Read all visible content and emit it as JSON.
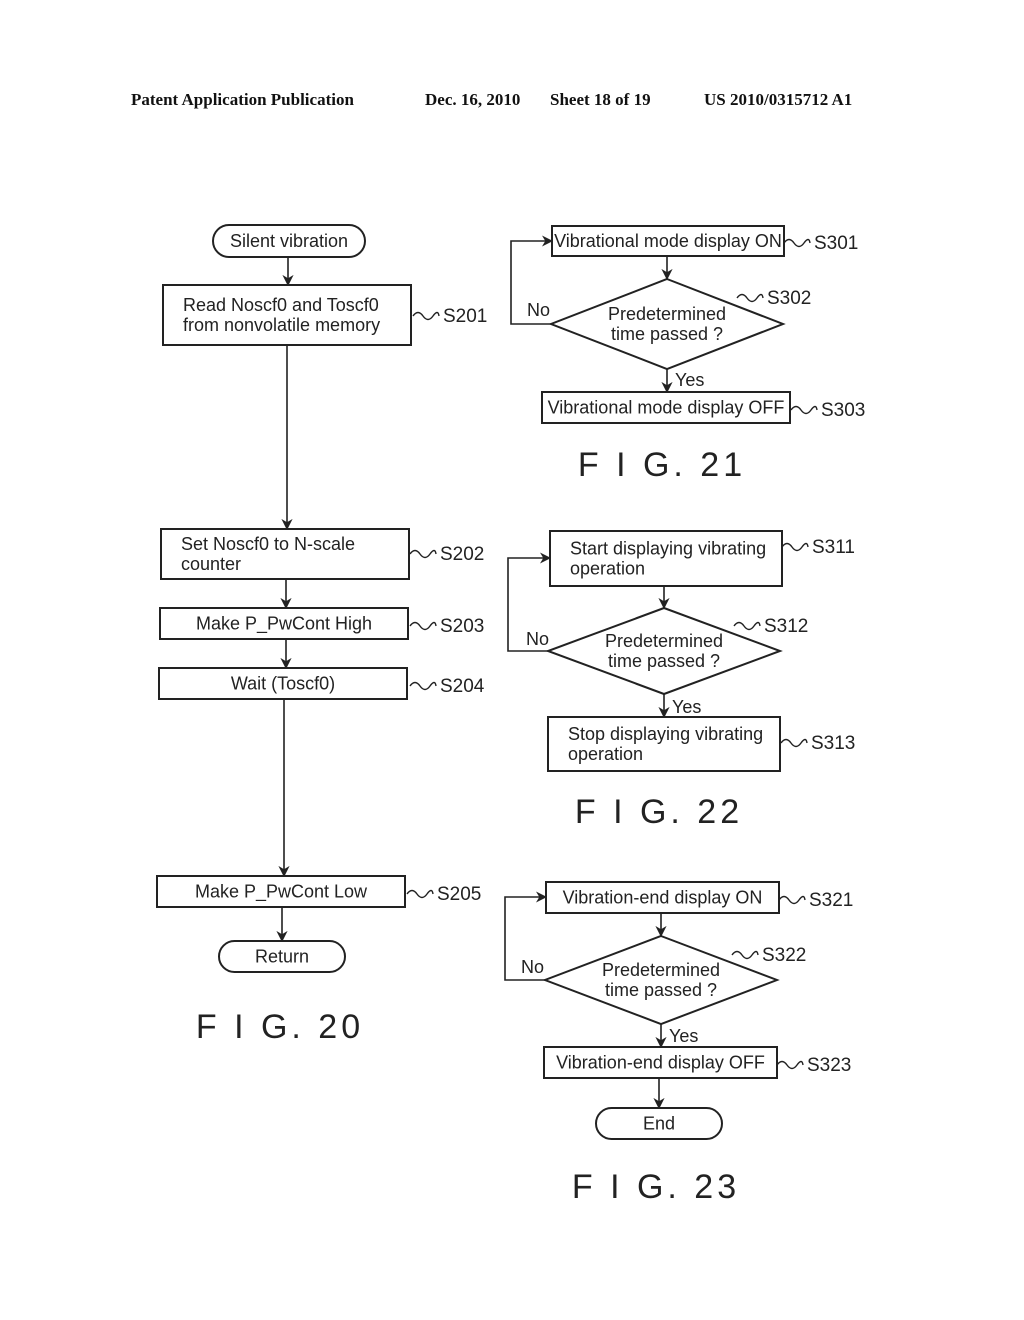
{
  "header": {
    "publication": "Patent Application Publication",
    "date": "Dec. 16, 2010",
    "sheet": "Sheet 18 of 19",
    "number": "US 2010/0315712 A1"
  },
  "figures": [
    {
      "id": "fig20",
      "caption": "F I G. 20",
      "nodes": [
        {
          "id": "start",
          "type": "terminal",
          "lines": [
            "Silent vibration"
          ]
        },
        {
          "id": "S201",
          "type": "process",
          "step": "S201",
          "lines": [
            "Read Noscf0 and Toscf0",
            "from nonvolatile memory"
          ]
        },
        {
          "id": "S202",
          "type": "process",
          "step": "S202",
          "lines": [
            "Set Noscf0 to N-scale",
            "counter"
          ]
        },
        {
          "id": "S203",
          "type": "process",
          "step": "S203",
          "lines": [
            "Make P_PwCont High"
          ]
        },
        {
          "id": "S204",
          "type": "process",
          "step": "S204",
          "lines": [
            "Wait (Toscf0)"
          ]
        },
        {
          "id": "S205",
          "type": "process",
          "step": "S205",
          "lines": [
            "Make P_PwCont Low"
          ]
        },
        {
          "id": "end",
          "type": "terminal",
          "lines": [
            "Return"
          ]
        }
      ],
      "edges": [
        {
          "from": "start",
          "to": "S201"
        },
        {
          "from": "S201",
          "to": "S202"
        },
        {
          "from": "S202",
          "to": "S203"
        },
        {
          "from": "S203",
          "to": "S204"
        },
        {
          "from": "S204",
          "to": "S205"
        },
        {
          "from": "S205",
          "to": "end"
        }
      ]
    },
    {
      "id": "fig21",
      "caption": "F I G. 21",
      "nodes": [
        {
          "id": "S301",
          "type": "process",
          "step": "S301",
          "lines": [
            "Vibrational mode display ON"
          ]
        },
        {
          "id": "S302",
          "type": "decision",
          "step": "S302",
          "lines": [
            "Predetermined",
            "time passed ?"
          ]
        },
        {
          "id": "S303",
          "type": "process",
          "step": "S303",
          "lines": [
            "Vibrational mode display OFF"
          ]
        }
      ],
      "edges": [
        {
          "from": "S301",
          "to": "S302"
        },
        {
          "from": "S302",
          "to": "S303",
          "label": "Yes"
        },
        {
          "from": "S302",
          "to": "S301",
          "label": "No"
        }
      ]
    },
    {
      "id": "fig22",
      "caption": "F I G. 22",
      "nodes": [
        {
          "id": "S311",
          "type": "process",
          "step": "S311",
          "lines": [
            "Start displaying vibrating",
            "operation"
          ]
        },
        {
          "id": "S312",
          "type": "decision",
          "step": "S312",
          "lines": [
            "Predetermined",
            "time passed ?"
          ]
        },
        {
          "id": "S313",
          "type": "process",
          "step": "S313",
          "lines": [
            "Stop displaying vibrating",
            "operation"
          ]
        }
      ],
      "edges": [
        {
          "from": "S311",
          "to": "S312"
        },
        {
          "from": "S312",
          "to": "S313",
          "label": "Yes"
        },
        {
          "from": "S312",
          "to": "S311",
          "label": "No"
        }
      ]
    },
    {
      "id": "fig23",
      "caption": "F I G. 23",
      "nodes": [
        {
          "id": "S321",
          "type": "process",
          "step": "S321",
          "lines": [
            "Vibration-end display ON"
          ]
        },
        {
          "id": "S322",
          "type": "decision",
          "step": "S322",
          "lines": [
            "Predetermined",
            "time passed ?"
          ]
        },
        {
          "id": "S323",
          "type": "process",
          "step": "S323",
          "lines": [
            "Vibration-end display OFF"
          ]
        },
        {
          "id": "end",
          "type": "terminal",
          "lines": [
            "End"
          ]
        }
      ],
      "edges": [
        {
          "from": "S321",
          "to": "S322"
        },
        {
          "from": "S322",
          "to": "S323",
          "label": "Yes"
        },
        {
          "from": "S322",
          "to": "S321",
          "label": "No"
        },
        {
          "from": "S323",
          "to": "end"
        }
      ]
    }
  ]
}
